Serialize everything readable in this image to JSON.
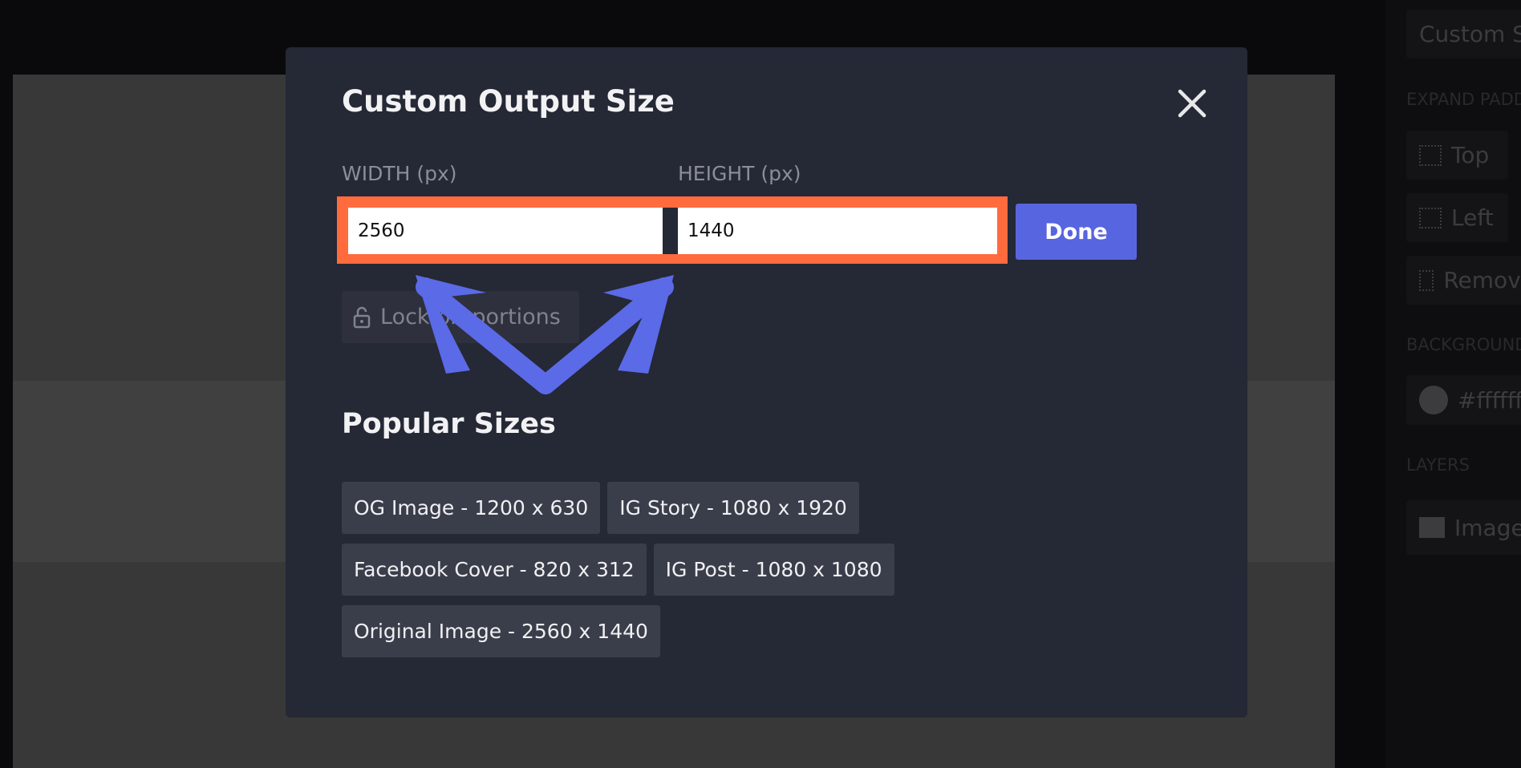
{
  "sidebar": {
    "custom_size_button": "Custom Size",
    "expand_padding_label": "EXPAND PADDING",
    "top_button": "Top",
    "left_button": "Left",
    "remove_button": "Remove",
    "background_label": "BACKGROUND",
    "background_color": "#ffffff",
    "layers_label": "LAYERS",
    "layer_image": "Image"
  },
  "modal": {
    "title": "Custom Output Size",
    "width_label": "WIDTH (px)",
    "height_label": "HEIGHT (px)",
    "width_value": "2560",
    "height_value": "1440",
    "done_label": "Done",
    "lock_label": "Lock proportions",
    "popular_title": "Popular Sizes",
    "popular_sizes": [
      "OG Image - 1200 x 630",
      "IG Story - 1080 x 1920",
      "Facebook Cover - 820 x 312",
      "IG Post - 1080 x 1080",
      "Original Image - 2560 x 1440"
    ]
  },
  "colors": {
    "highlight": "#ff6b3d",
    "accent": "#5865e0",
    "annotation_arrow": "#5b6ae6",
    "modal_bg": "#252835"
  }
}
